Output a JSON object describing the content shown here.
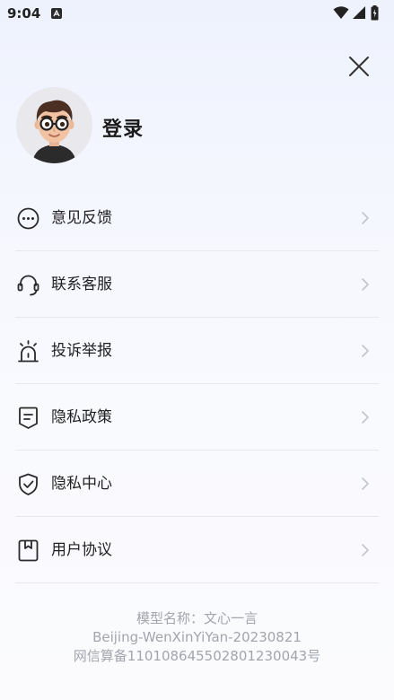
{
  "status_bar": {
    "time": "9:04"
  },
  "header": {
    "close_icon": "close-icon"
  },
  "profile": {
    "avatar_icon": "avatar-illustration",
    "login_label": "登录"
  },
  "menu": {
    "items": [
      {
        "label": "意见反馈",
        "icon": "feedback-chat-icon"
      },
      {
        "label": "联系客服",
        "icon": "headset-icon"
      },
      {
        "label": "投诉举报",
        "icon": "alarm-siren-icon"
      },
      {
        "label": "隐私政策",
        "icon": "policy-document-icon"
      },
      {
        "label": "隐私中心",
        "icon": "shield-check-icon"
      },
      {
        "label": "用户协议",
        "icon": "bookmark-document-icon"
      }
    ]
  },
  "footer": {
    "model_name": "模型名称：文心一言",
    "model_id": "Beijing-WenXinYiYan-20230821",
    "registration": "网信算备110108645502801230043号"
  },
  "colors": {
    "text_primary": "#222222",
    "text_muted": "#a3a5ad",
    "divider": "#e6e8ee",
    "background_top": "#eef2fd"
  }
}
